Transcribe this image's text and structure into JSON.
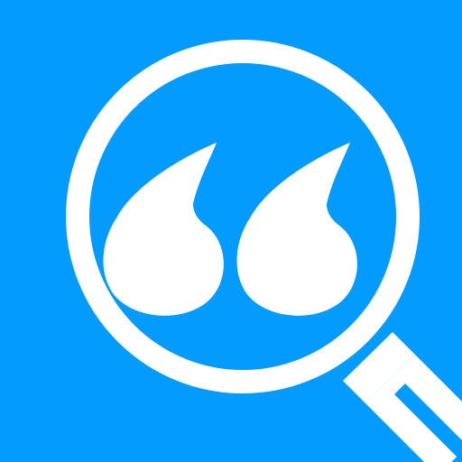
{
  "icon": {
    "name": "quote-search-icon",
    "background_color": "#039BFE",
    "foreground_color": "#FFFFFF",
    "glyphs": [
      "magnifying-glass-icon",
      "double-quote-icon"
    ]
  }
}
